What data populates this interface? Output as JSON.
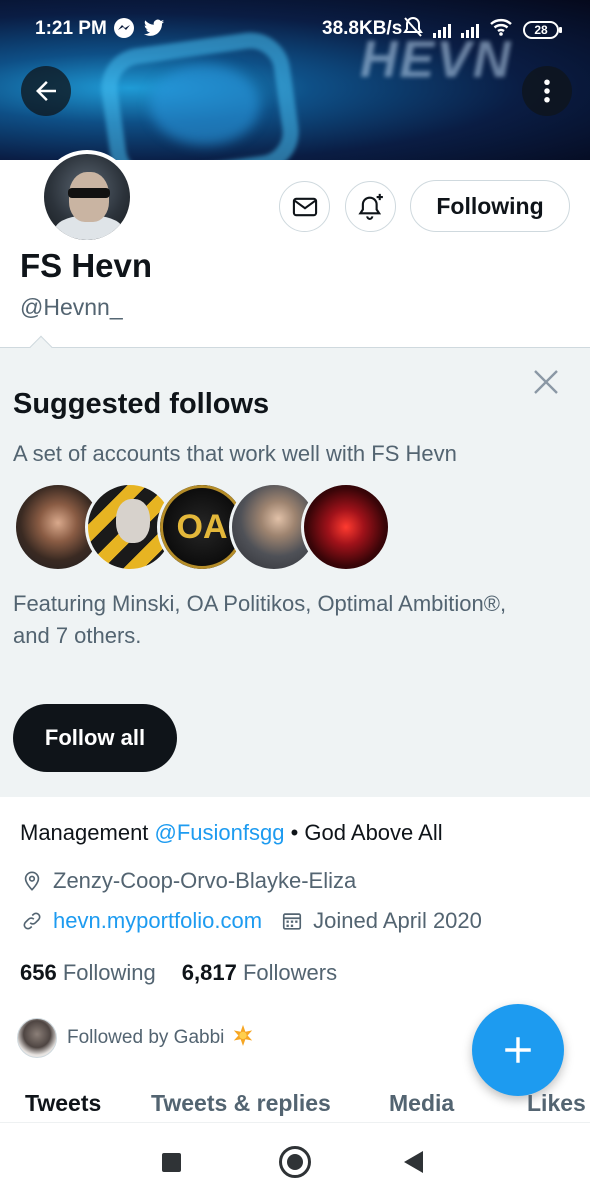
{
  "status_bar": {
    "time": "1:21 PM",
    "speed": "38.8KB/s",
    "battery": "28",
    "icons": [
      "messenger-icon",
      "twitter-icon",
      "mute-bell-icon",
      "signal-icon",
      "signal-icon",
      "wifi-icon",
      "battery-icon"
    ]
  },
  "banner": {
    "text": "HEVN"
  },
  "profile": {
    "display_name": "FS Hevn",
    "handle": "@Hevnn_",
    "following_button": "Following"
  },
  "suggested": {
    "title": "Suggested follows",
    "subtitle": "A set of accounts that work well with FS Hevn",
    "featuring": "Featuring Minski, OA Politikos, Optimal Ambition®, and 7 others.",
    "follow_all": "Follow all",
    "oa_logo": "OA"
  },
  "bio": {
    "prefix": "Management ",
    "mention": "@Fusionfsgg",
    "suffix": " • God Above All"
  },
  "location": "Zenzy-Coop-Orvo-Blayke-Eliza",
  "website": "hevn.myportfolio.com",
  "joined": "Joined April 2020",
  "counts": {
    "following_count": "656",
    "following_label": "Following",
    "followers_count": "6,817",
    "followers_label": "Followers"
  },
  "followed_by": "Followed by Gabbi",
  "tabs": [
    "Tweets",
    "Tweets & replies",
    "Media",
    "Likes"
  ],
  "colors": {
    "accent": "#1d9bf0",
    "text": "#0f1419",
    "muted": "#536471",
    "panel": "#eff3f4"
  }
}
